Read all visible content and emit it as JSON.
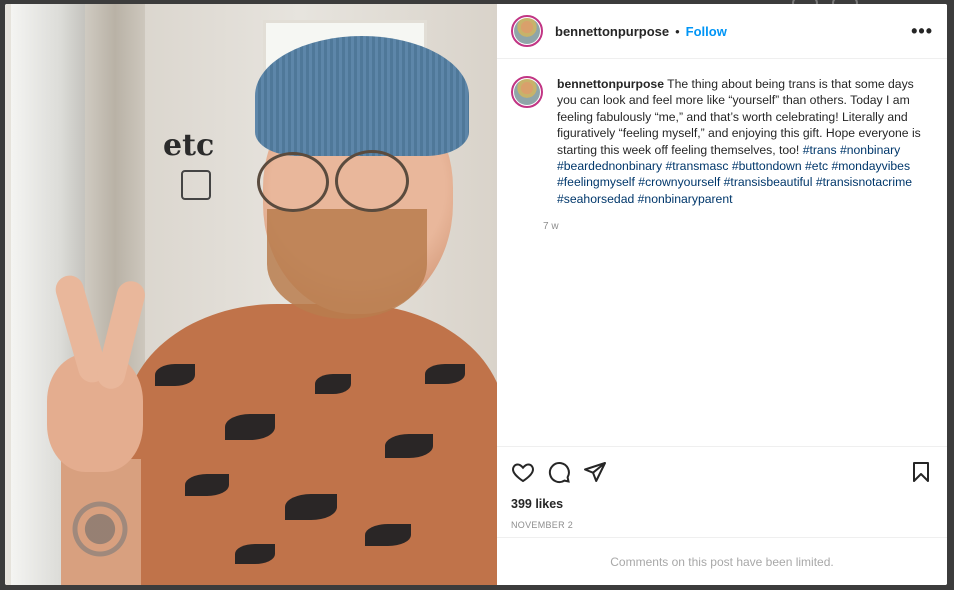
{
  "post": {
    "username": "bennettonpurpose",
    "follow_label": "Follow",
    "header_separator": "•",
    "more_label": "•••",
    "caption": {
      "username": "bennettonpurpose",
      "text": "The thing about being trans is that some days you can look and feel more like “yourself” than others. Today I am feeling fabulously “me,” and that’s worth celebrating! Literally and figuratively “feeling myself,” and enjoying this gift. Hope everyone is starting this week off feeling themselves, too!",
      "hashtags": [
        "#trans",
        "#nonbinary",
        "#beardednonbinary",
        "#transmasc",
        "#buttondown",
        "#etc",
        "#mondayvibes",
        "#feelingmyself",
        "#crownyourself",
        "#transisbeautiful",
        "#transisnotacrime",
        "#seahorsedad",
        "#nonbinaryparent"
      ],
      "time": "7 w"
    },
    "likes": "399 likes",
    "date": "NOVEMBER 2",
    "comments_limited": "Comments on this post have been limited.",
    "photo_sign": "etc"
  },
  "icons": {
    "like": "heart-icon",
    "comment": "comment-icon",
    "share": "share-icon",
    "save": "bookmark-icon",
    "more": "more-options-icon"
  }
}
